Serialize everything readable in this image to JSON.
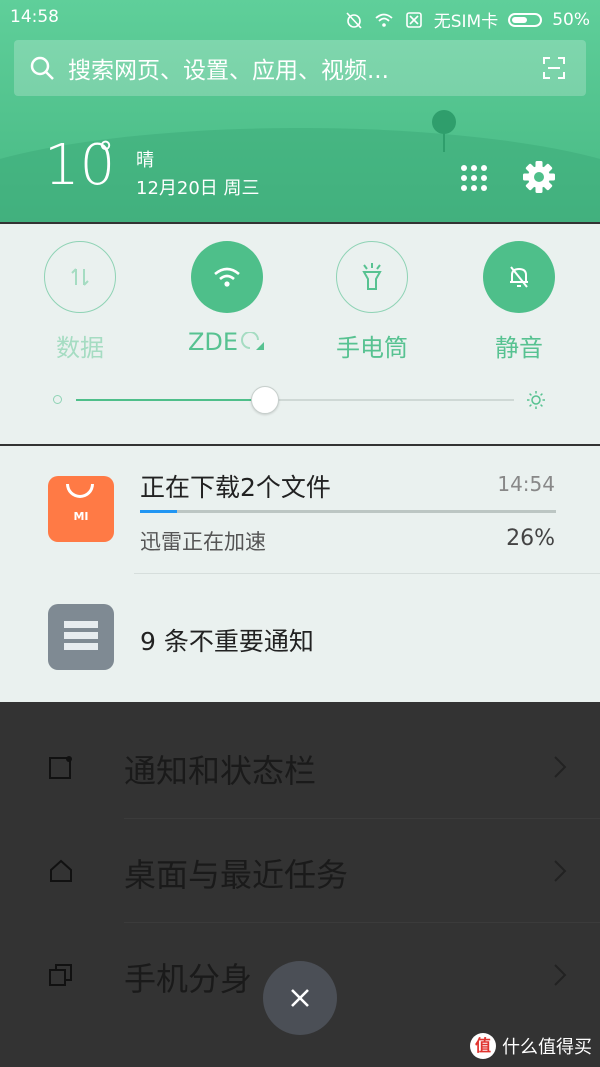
{
  "status_bar": {
    "time": "14:58",
    "sim": "无SIM卡",
    "battery": "50%",
    "battery_level": 0.5
  },
  "search": {
    "placeholder": "搜索网页、设置、应用、视频..."
  },
  "weather": {
    "temp": "10",
    "degree": "°",
    "condition": "晴",
    "date": "12月20日 周三"
  },
  "quick_settings": {
    "toggles": [
      {
        "label": "数据",
        "icon": "data-arrows-icon",
        "on": false
      },
      {
        "label": "ZDE",
        "icon": "wifi-icon",
        "on": true
      },
      {
        "label": "手电筒",
        "icon": "flashlight-icon",
        "on": false
      },
      {
        "label": "静音",
        "icon": "bell-off-icon",
        "on": true
      }
    ],
    "brightness_level": 0.43
  },
  "notifications": {
    "download": {
      "title": "正在下载2个文件",
      "time": "14:54",
      "subtitle": "迅雷正在加速",
      "progress_text": "26%",
      "progress": 0.09,
      "app_icon_text": "MI"
    },
    "unimportant": {
      "title": "9 条不重要通知"
    }
  },
  "background_settings": {
    "items": [
      {
        "label": "通知和状态栏"
      },
      {
        "label": "桌面与最近任务"
      },
      {
        "label": "手机分身"
      }
    ]
  },
  "watermark": {
    "logo": "值",
    "text": "什么值得买"
  },
  "colors": {
    "accent": "#4ebf8a",
    "header": "#5fcf9a",
    "panel_bg": "#eaf1ef",
    "mi_orange": "#ff7a45"
  }
}
